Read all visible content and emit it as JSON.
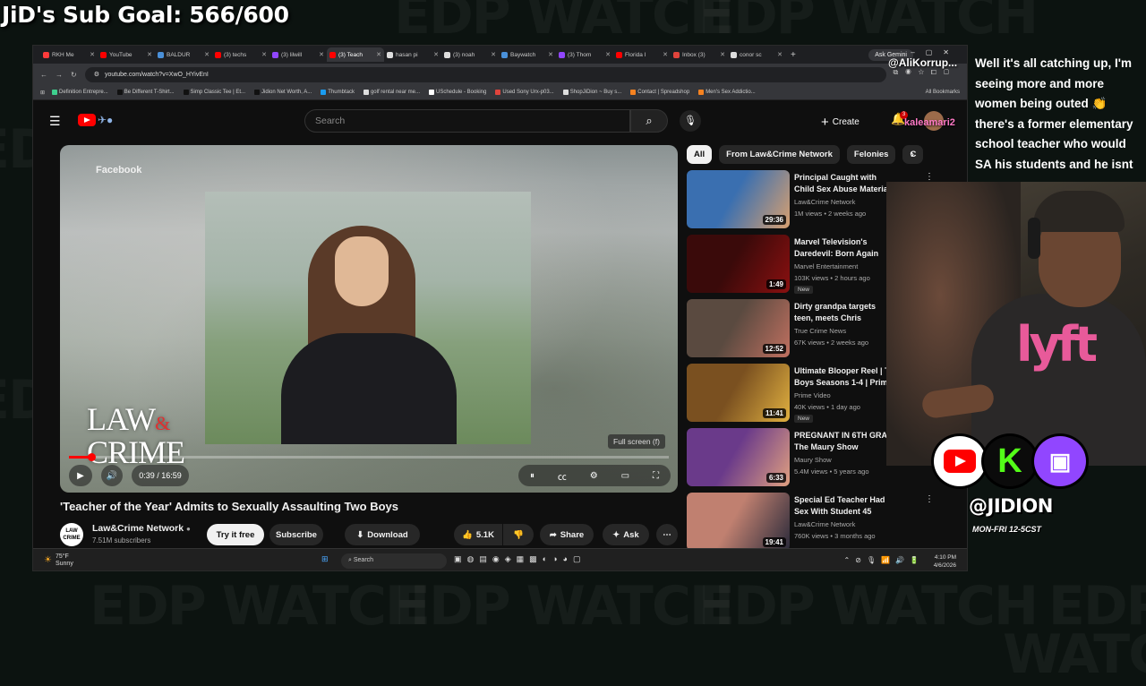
{
  "overlay": {
    "sub_goal": "JiD's Sub Goal: 566/600",
    "watermark": "EDP WATCH",
    "tweet_text": "Well it's all catching up, I'm seeing more and more women being outed 👏 there's a former elementary school teacher who would SA his students and he isnt",
    "chat_user_1": "@AliKorrup...",
    "chat_user_2": "kaleamari2",
    "handle": "@JIDION",
    "schedule": "MON-FRI 12-5CST",
    "social": {
      "youtube": "youtube-icon",
      "kick": "K",
      "twitch": "twitch-icon"
    },
    "colors": {
      "youtube": "#ff0000",
      "kick": "#53fc18",
      "twitch": "#9146ff",
      "lyft": "#e85a9a"
    }
  },
  "browser": {
    "tabs": [
      {
        "label": "RKH Me",
        "color": "#ff3b3b"
      },
      {
        "label": "YouTube",
        "color": "#ff0000"
      },
      {
        "label": "BALDUR",
        "color": "#4a90d9"
      },
      {
        "label": "(3) techs",
        "color": "#ff0000"
      },
      {
        "label": "(3) lilwill",
        "color": "#9146ff"
      },
      {
        "label": "(3) Teach",
        "color": "#ff0000",
        "active": true
      },
      {
        "label": "hasan pi",
        "color": "#dddddd"
      },
      {
        "label": "(3) noah",
        "color": "#dddddd"
      },
      {
        "label": "Baywatch",
        "color": "#4a90d9"
      },
      {
        "label": "(3) Thom",
        "color": "#9146ff"
      },
      {
        "label": "Florida I",
        "color": "#ff0000"
      },
      {
        "label": "Inbox (3)",
        "color": "#e0443c"
      },
      {
        "label": "conor sc",
        "color": "#dddddd"
      }
    ],
    "ask_gemini": "Ask Gemini",
    "url": "youtube.com/watch?v=XwO_HYivEnI",
    "bookmarks": [
      {
        "label": "Definition Entrepre...",
        "color": "#3ecf8e"
      },
      {
        "label": "Be Different T-Shirt...",
        "color": "#111111"
      },
      {
        "label": "Simp Classic Tee | Et...",
        "color": "#111111"
      },
      {
        "label": "Jidion Net Worth, A...",
        "color": "#111111"
      },
      {
        "label": "Thumbtack",
        "color": "#1a9cf0"
      },
      {
        "label": "golf rental near me...",
        "color": "#dddddd"
      },
      {
        "label": "USchedule - Booking",
        "color": "#ffffff"
      },
      {
        "label": "Used Sony Urx-p03...",
        "color": "#e0443c"
      },
      {
        "label": "ShopJiDion ~ Buy s...",
        "color": "#dddddd"
      },
      {
        "label": "Contact | Spreadshop",
        "color": "#f58220"
      },
      {
        "label": "Men's Sex Addictio...",
        "color": "#f58220"
      }
    ],
    "all_bookmarks": "All Bookmarks"
  },
  "youtube": {
    "search_placeholder": "Search",
    "create_label": "Create",
    "notif_count": "3",
    "player": {
      "source_label": "Facebook",
      "law_text": "LAW",
      "amp": "&",
      "crime_text": "CRIME",
      "fullscreen_tip": "Full screen (f)",
      "time": "0:39 / 16:59",
      "progress": 0.038
    },
    "video_title": "'Teacher of the Year' Admits to Sexually Assaulting Two Boys",
    "channel": {
      "name": "Law&Crime Network",
      "subs": "7.51M subscribers",
      "logo_text": "LAW CRIME"
    },
    "actions": {
      "try_free": "Try it free",
      "subscribe": "Subscribe",
      "download": "Download",
      "likes": "5.1K",
      "share": "Share",
      "ask": "Ask"
    },
    "chips": [
      "All",
      "From Law&Crime Network",
      "Felonies",
      "C"
    ],
    "recommended": [
      {
        "title": "Principal Caught with Child Sex Abuse Material",
        "channel": "Law&Crime Network",
        "meta": "1M views • 2 weeks ago",
        "duration": "29:36",
        "new": "",
        "thumb": "#3a6fb0",
        "thumb2": "#d8a070"
      },
      {
        "title": "Marvel Television's Daredevil: Born Again Season 2 | O",
        "channel": "Marvel Entertainment",
        "meta": "103K views • 2 hours ago",
        "duration": "1:49",
        "new": "New",
        "thumb": "#3a0a0a",
        "thumb2": "#8a1010"
      },
      {
        "title": "Dirty grandpa targets teen, meets Chris Hansen inst",
        "channel": "True Crime News",
        "meta": "67K views • 2 weeks ago",
        "duration": "12:52",
        "new": "",
        "thumb": "#5a4a40",
        "thumb2": "#c07060"
      },
      {
        "title": "Ultimate Blooper Reel | T Boys Seasons 1-4 | Prim",
        "channel": "Prime Video",
        "meta": "40K views • 1 day ago",
        "duration": "11:41",
        "new": "New",
        "thumb": "#7a5020",
        "thumb2": "#e0b040"
      },
      {
        "title": "PREGNANT IN 6TH GRA The Maury Show",
        "channel": "Maury Show",
        "meta": "5.4M views • 5 years ago",
        "duration": "6:33",
        "new": "",
        "thumb": "#6a3a8a",
        "thumb2": "#e0a080"
      },
      {
        "title": "Special Ed Teacher Had Sex With Student 45 Times: ...",
        "channel": "Law&Crime Network",
        "meta": "760K views • 3 months ago",
        "duration": "19:41",
        "new": "",
        "thumb": "#c08070",
        "thumb2": "#2a2a3a"
      }
    ]
  },
  "taskbar": {
    "temp": "75°F",
    "weather": "Sunny",
    "search": "Search",
    "time": "4:10 PM",
    "date": "4/6/2026"
  }
}
